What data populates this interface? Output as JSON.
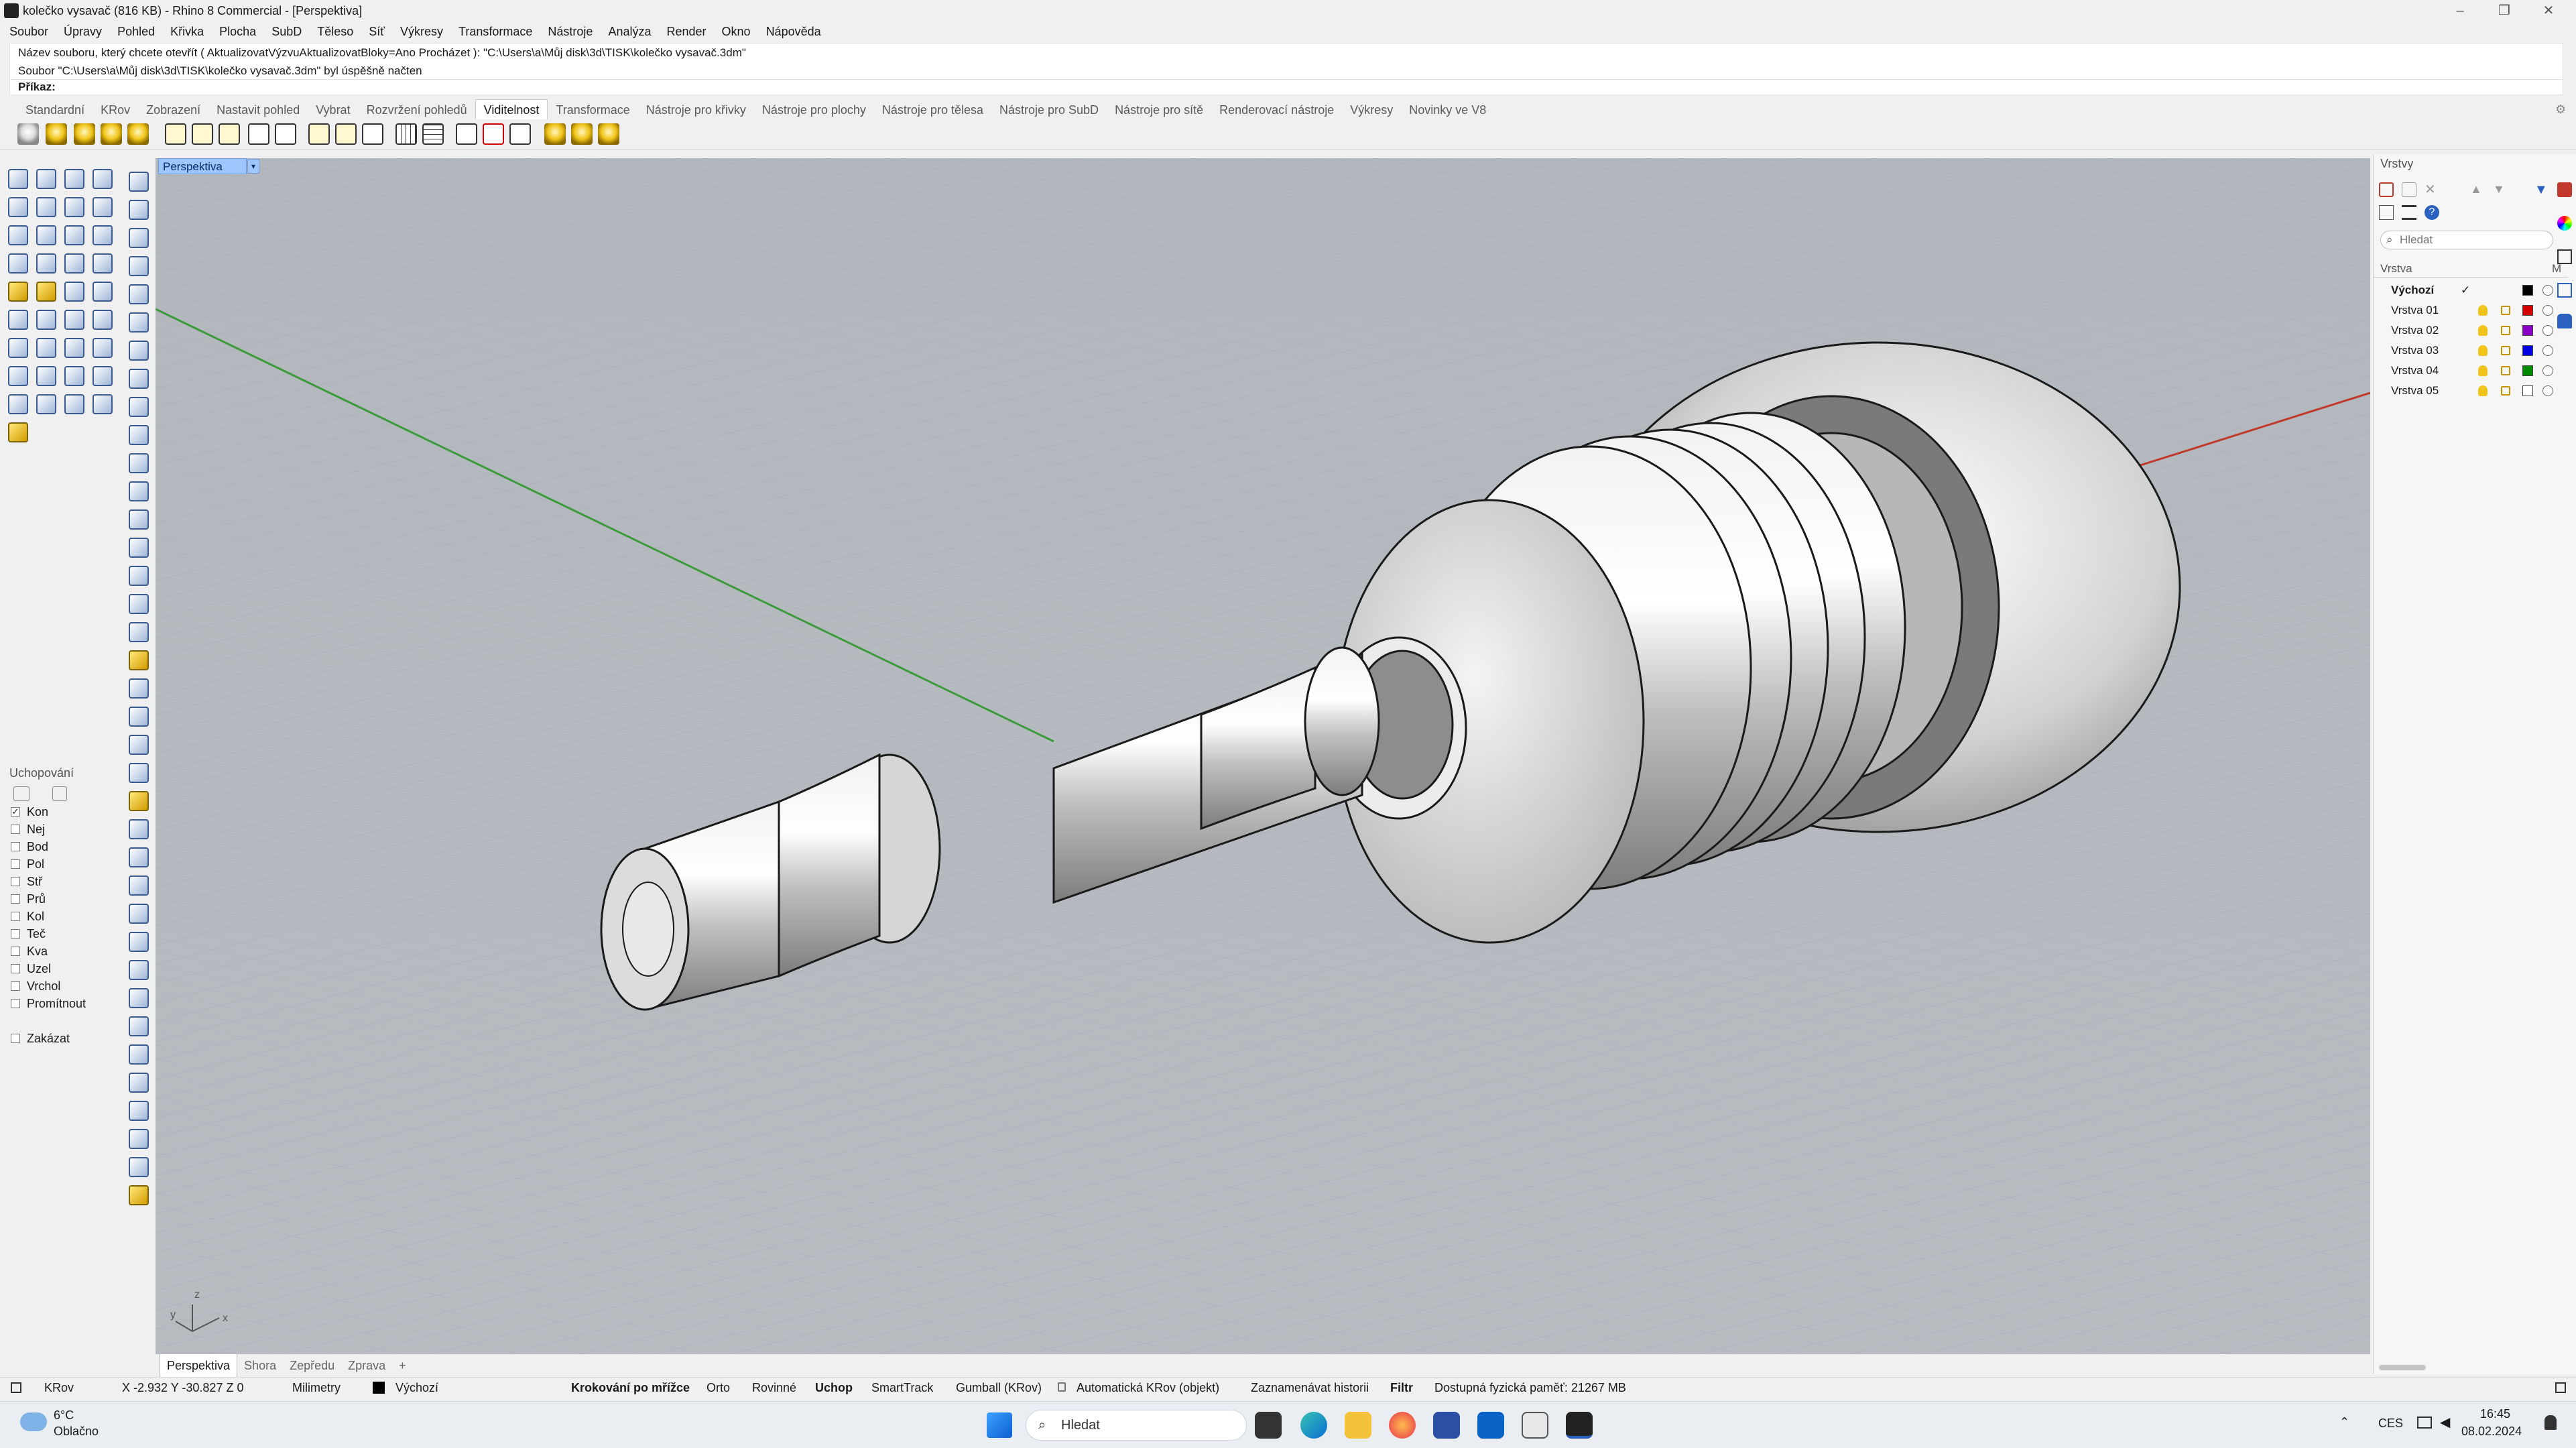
{
  "window": {
    "title": "kolečko vysavač (816 KB) - Rhino 8 Commercial - [Perspektiva]"
  },
  "menu": [
    "Soubor",
    "Úpravy",
    "Pohled",
    "Křivka",
    "Plocha",
    "SubD",
    "Těleso",
    "Síť",
    "Výkresy",
    "Transformace",
    "Nástroje",
    "Analýza",
    "Render",
    "Okno",
    "Nápověda"
  ],
  "command_history": [
    "Název souboru, který chcete otevřít ( AktualizovatVýzvuAktualizovatBloky=Ano  Procházet ): \"C:\\Users\\a\\Můj disk\\3d\\TISK\\kolečko vysavač.3dm\"",
    "Soubor \"C:\\Users\\a\\Můj disk\\3d\\TISK\\kolečko vysavač.3dm\" byl úspěšně načten"
  ],
  "command_prompt": "Příkaz:",
  "toolbar_tabs": [
    "Standardní",
    "KRov",
    "Zobrazení",
    "Nastavit pohled",
    "Vybrat",
    "Rozvržení pohledů",
    "Viditelnost",
    "Transformace",
    "Nástroje pro křivky",
    "Nástroje pro plochy",
    "Nástroje pro tělesa",
    "Nástroje pro SubD",
    "Nástroje pro sítě",
    "Renderovací nástroje",
    "Výkresy",
    "Novinky ve V8"
  ],
  "active_toolbar_tab": "Viditelnost",
  "viewport": {
    "title": "Perspektiva",
    "axis_x": "x",
    "axis_y": "y",
    "axis_z": "z"
  },
  "viewport_tabs": [
    "Perspektiva",
    "Shora",
    "Zepředu",
    "Zprava"
  ],
  "osnap": {
    "title": "Uchopování",
    "items": [
      {
        "label": "Kon",
        "checked": true
      },
      {
        "label": "Nej",
        "checked": false
      },
      {
        "label": "Bod",
        "checked": false
      },
      {
        "label": "Pol",
        "checked": false
      },
      {
        "label": "Stř",
        "checked": false
      },
      {
        "label": "Prů",
        "checked": false
      },
      {
        "label": "Kol",
        "checked": false
      },
      {
        "label": "Teč",
        "checked": false
      },
      {
        "label": "Kva",
        "checked": false
      },
      {
        "label": "Uzel",
        "checked": false
      },
      {
        "label": "Vrchol",
        "checked": false
      },
      {
        "label": "Promítnout",
        "checked": false
      }
    ],
    "disable": "Zakázat"
  },
  "layers_panel": {
    "title": "Vrstvy",
    "search_placeholder": "Hledat",
    "col_name": "Vrstva",
    "col_material": "M",
    "current_mark": "✓",
    "rows": [
      {
        "name": "Výchozí",
        "color": "#000000",
        "current": true
      },
      {
        "name": "Vrstva 01",
        "color": "#d40000",
        "current": false
      },
      {
        "name": "Vrstva 02",
        "color": "#8b00c9",
        "current": false
      },
      {
        "name": "Vrstva 03",
        "color": "#0000e0",
        "current": false
      },
      {
        "name": "Vrstva 04",
        "color": "#008a00",
        "current": false
      },
      {
        "name": "Vrstva 05",
        "color": "#ffffff",
        "current": false
      }
    ]
  },
  "statusbar": {
    "cplane": "KRov",
    "coords": "X -2.932 Y -30.827 Z 0",
    "units": "Milimetry",
    "layer": "Výchozí",
    "grid_snap": "Krokování po mřížce",
    "ortho": "Orto",
    "planar": "Rovinné",
    "osnap": "Uchop",
    "smarttrack": "SmartTrack",
    "gumball": "Gumball (KRov)",
    "auto_cplane": "Automatická KRov (objekt)",
    "history": "Zaznamenávat historii",
    "filter": "Filtr",
    "memory": "Dostupná fyzická paměť: 21267 MB"
  },
  "taskbar": {
    "temp": "6°C",
    "weather": "Oblačno",
    "search": "Hledat",
    "lang": "CES",
    "time": "16:45",
    "date": "08.02.2024"
  },
  "colors": {
    "accent": "#9fc5ff",
    "viewport_bg": "#b4b9bf",
    "x_axis": "#c0392b",
    "y_axis": "#3c9a3c"
  }
}
